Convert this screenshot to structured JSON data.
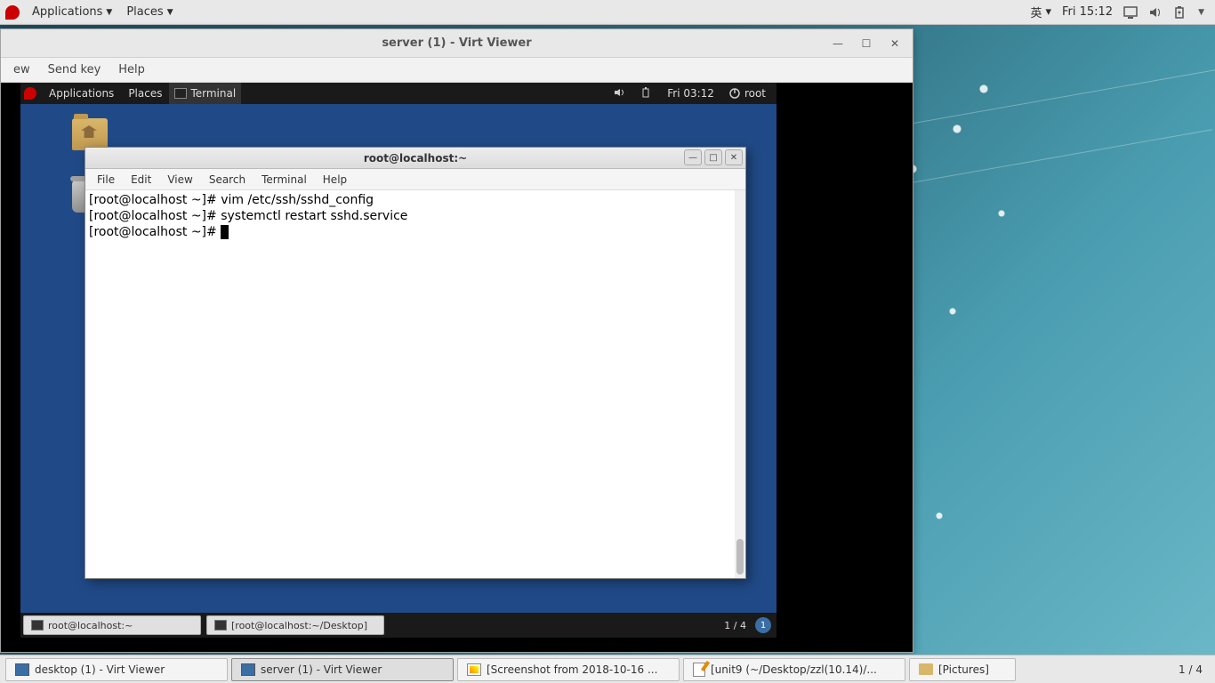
{
  "host_panel": {
    "applications": "Applications",
    "places": "Places",
    "ime": "英",
    "clock": "Fri 15:12"
  },
  "virt_window": {
    "title": "server (1) - Virt Viewer",
    "menus": {
      "view_tail": "ew",
      "sendkey": "Send key",
      "help": "Help"
    }
  },
  "guest_panel": {
    "applications": "Applications",
    "places": "Places",
    "terminal_launcher": "Terminal",
    "clock": "Fri 03:12",
    "user": "root"
  },
  "guest_desktop": {
    "home": "ho",
    "trash": "Tr"
  },
  "guest_term": {
    "title": "root@localhost:~",
    "menus": {
      "file": "File",
      "edit": "Edit",
      "view": "View",
      "search": "Search",
      "terminal": "Terminal",
      "help": "Help"
    },
    "lines": [
      "[root@localhost ~]# vim /etc/ssh/sshd_config",
      "[root@localhost ~]# systemctl restart sshd.service",
      "[root@localhost ~]# "
    ]
  },
  "guest_taskbar": {
    "task1": "root@localhost:~",
    "task2": "[root@localhost:~/Desktop]",
    "workspace": "1 / 4",
    "ws_badge": "1"
  },
  "host_taskbar": {
    "task1": "desktop (1) - Virt Viewer",
    "task2": "server (1) - Virt Viewer",
    "task3": "[Screenshot from 2018-10-16 ...",
    "task4": "[unit9 (~/Desktop/zzl(10.14)/...",
    "task5": "[Pictures]",
    "workspace": "1 / 4"
  }
}
